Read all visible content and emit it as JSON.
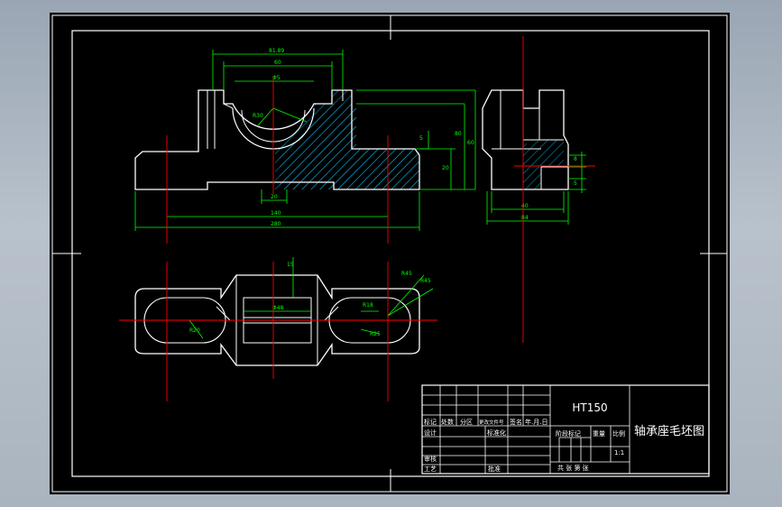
{
  "dimensions": {
    "top_overall": "81.89",
    "top_inner": "60",
    "top_bore": "Φ5",
    "radius_r": "R30",
    "depth_20": "20",
    "length_140": "140",
    "length_280": "280",
    "height_5": "5",
    "height_60": "60",
    "height_80": "80",
    "height_20": "20",
    "side_8": "8",
    "side_5": "5",
    "side_40": "40",
    "side_84": "84",
    "plan_15": "15",
    "plan_48": "Φ48",
    "plan_r45": "R45",
    "plan_r45b": "R45",
    "plan_r18": "R18",
    "plan_r25": "R25",
    "plan_r20": "R20"
  },
  "title_block": {
    "material": "HT150",
    "drawing_name": "轴承座毛坯图",
    "row_labels": [
      "标记",
      "处数",
      "分区",
      "更改文件号",
      "签名",
      "年.月.日"
    ],
    "design": "设计",
    "standardize": "标准化",
    "review": "审核",
    "process": "工艺",
    "approve": "批准",
    "stage_mark": "阶段标记",
    "weight": "重量",
    "ratio": "比例",
    "scale_value": "1:1",
    "sheet_info": "共    张  第    张"
  },
  "colors": {
    "outline": "#ffffff",
    "dimension": "#00ff00",
    "centerline": "#ff0000",
    "hatch": "#00c8ff",
    "background": "#000000"
  }
}
